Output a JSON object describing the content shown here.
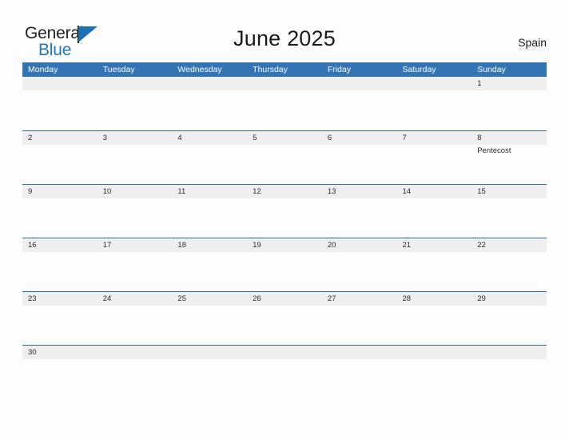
{
  "brand": {
    "word_one": "General",
    "word_two": "Blue",
    "triangle_icon": "triangle-flag-icon",
    "colors": {
      "blue": "#2077bd",
      "dark": "#231f20"
    }
  },
  "header": {
    "title": "June 2025",
    "country": "Spain"
  },
  "calendar": {
    "colors": {
      "header_blue": "#3274b4",
      "row_line_blue": "#2d6fae",
      "date_band_gray": "#efefef",
      "page_background": "#fdfdfd"
    },
    "day_headers": [
      "Monday",
      "Tuesday",
      "Wednesday",
      "Thursday",
      "Friday",
      "Saturday",
      "Sunday"
    ],
    "weeks": [
      [
        {
          "date": ""
        },
        {
          "date": ""
        },
        {
          "date": ""
        },
        {
          "date": ""
        },
        {
          "date": ""
        },
        {
          "date": ""
        },
        {
          "date": "1"
        }
      ],
      [
        {
          "date": "2"
        },
        {
          "date": "3"
        },
        {
          "date": "4"
        },
        {
          "date": "5"
        },
        {
          "date": "6"
        },
        {
          "date": "7"
        },
        {
          "date": "8",
          "event": "Pentecost"
        }
      ],
      [
        {
          "date": "9"
        },
        {
          "date": "10"
        },
        {
          "date": "11"
        },
        {
          "date": "12"
        },
        {
          "date": "13"
        },
        {
          "date": "14"
        },
        {
          "date": "15"
        }
      ],
      [
        {
          "date": "16"
        },
        {
          "date": "17"
        },
        {
          "date": "18"
        },
        {
          "date": "19"
        },
        {
          "date": "20"
        },
        {
          "date": "21"
        },
        {
          "date": "22"
        }
      ],
      [
        {
          "date": "23"
        },
        {
          "date": "24"
        },
        {
          "date": "25"
        },
        {
          "date": "26"
        },
        {
          "date": "27"
        },
        {
          "date": "28"
        },
        {
          "date": "29"
        }
      ],
      [
        {
          "date": "30"
        },
        {
          "date": ""
        },
        {
          "date": ""
        },
        {
          "date": ""
        },
        {
          "date": ""
        },
        {
          "date": ""
        },
        {
          "date": ""
        }
      ]
    ]
  }
}
